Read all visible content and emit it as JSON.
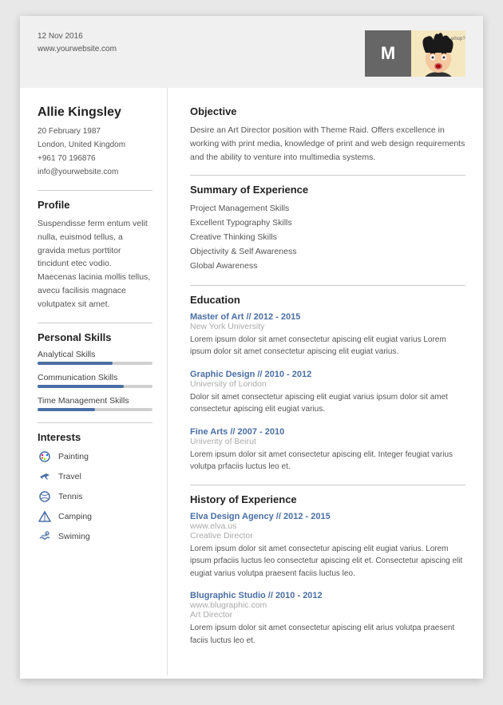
{
  "header": {
    "date": "12 Nov 2016",
    "website": "www.yourwebsite.com",
    "initial": "M"
  },
  "person": {
    "name": "Allie Kingsley",
    "dob": "20 February 1987",
    "location": "London, United Kingdom",
    "phone": "+961 70 196876",
    "email": "info@yourwebsite.com"
  },
  "profile": {
    "title": "Profile",
    "text": "Suspendisse ferm entum velit nulla, euismod tellus, a gravida metus porttitor tincidunt etec vodio. Maecenas lacinia mollis tellus, avecu facilisis magnace volutpatex sit amet."
  },
  "personal_skills": {
    "title": "Personal Skills",
    "skills": [
      {
        "label": "Analytical Skills",
        "percent": 65
      },
      {
        "label": "Communication Skills",
        "percent": 75
      },
      {
        "label": "Time Management Skills",
        "percent": 50
      }
    ]
  },
  "interests": {
    "title": "Interests",
    "items": [
      {
        "label": "Painting",
        "icon": "palette"
      },
      {
        "label": "Travel",
        "icon": "plane"
      },
      {
        "label": "Tennis",
        "icon": "tennis"
      },
      {
        "label": "Camping",
        "icon": "tent"
      },
      {
        "label": "Swiming",
        "icon": "swim"
      }
    ]
  },
  "objective": {
    "title": "Objective",
    "text": "Desire an Art Director position with Theme Raid. Offers excellence in working with print media, knowledge of print and web design requirements and the ability to venture into multimedia systems."
  },
  "summary": {
    "title": "Summary of Experience",
    "items": [
      "Project Management Skills",
      "Excellent Typography Skills",
      "Creative Thinking Skills",
      "Objectivity & Self Awareness",
      "Global Awareness"
    ]
  },
  "education": {
    "title": "Education",
    "entries": [
      {
        "title": "Master of Art // 2012 - 2015",
        "school": "New York University",
        "desc": "Lorem ipsum dolor sit amet consectetur apiscing elit eugiat varius Lorem ipsum dolor sit amet consectetur apiscing elit eugiat varius."
      },
      {
        "title": "Graphic Design // 2010 - 2012",
        "school": "University of London",
        "desc": "Dolor sit amet consectetur apiscing elit eugiat varius  ipsum dolor sit amet consectetur apiscing elit eugiat varius."
      },
      {
        "title": "Fine Arts // 2007 - 2010",
        "school": "Univerity of Beirut",
        "desc": "Lorem ipsum dolor sit amet consectetur apiscing elit. Integer feugiat varius volutpa prfaciis luctus leo et."
      }
    ]
  },
  "experience": {
    "title": "History of Experience",
    "entries": [
      {
        "title": "Elva Design Agency // 2012 - 2015",
        "company": "www.elva.us",
        "role": "Creative Director",
        "desc": "Lorem ipsum dolor sit amet consectetur apiscing elit eugiat varius. Lorem ipsum prfaciis luctus leo consectetur apiscing elit et. Consectetur apiscing elit eugiat varius volutpa praesent faciis luctus leo."
      },
      {
        "title": "Blugraphic Studio // 2010 - 2012",
        "company": "www.blugraphic.com",
        "role": "Art Director",
        "desc": "Lorem ipsum dolor sit amet consectetur apiscing elit arius volutpa praesent faciis luctus leo et."
      }
    ]
  }
}
